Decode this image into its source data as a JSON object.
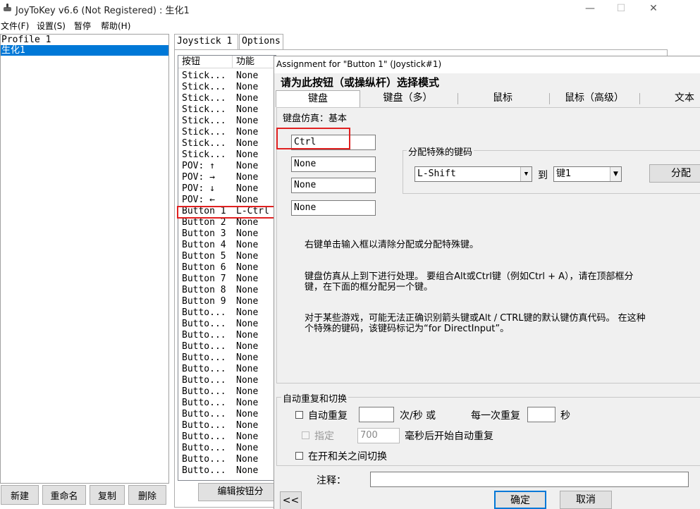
{
  "main_window": {
    "title": "JoyToKey v6.6 (Not Registered) : 生化1",
    "menu": [
      "文件(F)",
      "设置(S)",
      "暂停",
      "帮助(H)"
    ],
    "win_minimize": "—",
    "win_maximize": "☐",
    "win_close": "✕"
  },
  "profiles": [
    "Profile 1",
    "生化1"
  ],
  "bottom_buttons": {
    "new": "新建",
    "rename": "重命名",
    "copy": "复制",
    "delete": "删除"
  },
  "tabs": {
    "joystick": "Joystick 1",
    "options": "Options"
  },
  "button_list": {
    "headers": {
      "button": "按钮",
      "function": "功能"
    },
    "rows": [
      {
        "button": "Stick...",
        "function": "None"
      },
      {
        "button": "Stick...",
        "function": "None"
      },
      {
        "button": "Stick...",
        "function": "None"
      },
      {
        "button": "Stick...",
        "function": "None"
      },
      {
        "button": "Stick...",
        "function": "None"
      },
      {
        "button": "Stick...",
        "function": "None"
      },
      {
        "button": "Stick...",
        "function": "None"
      },
      {
        "button": "Stick...",
        "function": "None"
      },
      {
        "button": "POV: ↑",
        "function": "None"
      },
      {
        "button": "POV: →",
        "function": "None"
      },
      {
        "button": "POV: ↓",
        "function": "None"
      },
      {
        "button": "POV: ←",
        "function": "None"
      },
      {
        "button": "Button 1",
        "function": "L-Ctrl"
      },
      {
        "button": "Button 2",
        "function": "None"
      },
      {
        "button": "Button 3",
        "function": "None"
      },
      {
        "button": "Button 4",
        "function": "None"
      },
      {
        "button": "Button 5",
        "function": "None"
      },
      {
        "button": "Button 6",
        "function": "None"
      },
      {
        "button": "Button 7",
        "function": "None"
      },
      {
        "button": "Button 8",
        "function": "None"
      },
      {
        "button": "Button 9",
        "function": "None"
      },
      {
        "button": "Butto...",
        "function": "None"
      },
      {
        "button": "Butto...",
        "function": "None"
      },
      {
        "button": "Butto...",
        "function": "None"
      },
      {
        "button": "Butto...",
        "function": "None"
      },
      {
        "button": "Butto...",
        "function": "None"
      },
      {
        "button": "Butto...",
        "function": "None"
      },
      {
        "button": "Butto...",
        "function": "None"
      },
      {
        "button": "Butto...",
        "function": "None"
      },
      {
        "button": "Butto...",
        "function": "None"
      },
      {
        "button": "Butto...",
        "function": "None"
      },
      {
        "button": "Butto...",
        "function": "None"
      },
      {
        "button": "Butto...",
        "function": "None"
      },
      {
        "button": "Butto...",
        "function": "None"
      },
      {
        "button": "Butto...",
        "function": "None"
      },
      {
        "button": "Butto...",
        "function": "None"
      }
    ],
    "edit_button": "编辑按钮分"
  },
  "dialog": {
    "title": "Assignment for \"Button 1\" (Joystick#1)",
    "heading": "请为此按钮（或操纵杆）选择模式",
    "mode_tabs": [
      "键盘",
      "键盘（多）",
      "鼠标",
      "鼠标（高级）",
      "文本"
    ],
    "kb_group_label": "键盘仿真：基本",
    "key_fields": [
      "Ctrl",
      "None",
      "None",
      "None"
    ],
    "special_group_label": "分配特殊的键码",
    "special_key": "L-Shift",
    "to_label": "到",
    "target_key": "键1",
    "assign_button": "分配",
    "hint1": "右键单击输入框以清除分配或分配特殊键。",
    "hint2_line1": "键盘仿真从上到下进行处理。 要组合Alt或Ctrl键（例如Ctrl + A），请在顶部框分",
    "hint2_line2": "键，在下面的框分配另一个键。",
    "hint3_line1": "对于某些游戏，可能无法正确识别箭头键或Alt / CTRL键的默认键仿真代码。 在这种",
    "hint3_line2": "个特殊的键码，该键码标记为“for DirectInput”。",
    "repeat_group_label": "自动重复和切换",
    "auto_repeat_label": "自动重复",
    "times_per_sec": "次/秒 或",
    "per_repeat": "每一次重复",
    "seconds": "秒",
    "specify_label": "指定",
    "delay_value": "700",
    "delay_suffix": "毫秒后开始自动重复",
    "toggle_label": "在开和关之间切换",
    "note_label": "注释：",
    "prev_button": "<<",
    "ok_button": "确定",
    "cancel_button": "取消"
  },
  "colors": {
    "selection": "#0078d7",
    "highlight_box": "#e02020",
    "dialog_bg": "#f0f0f0"
  }
}
